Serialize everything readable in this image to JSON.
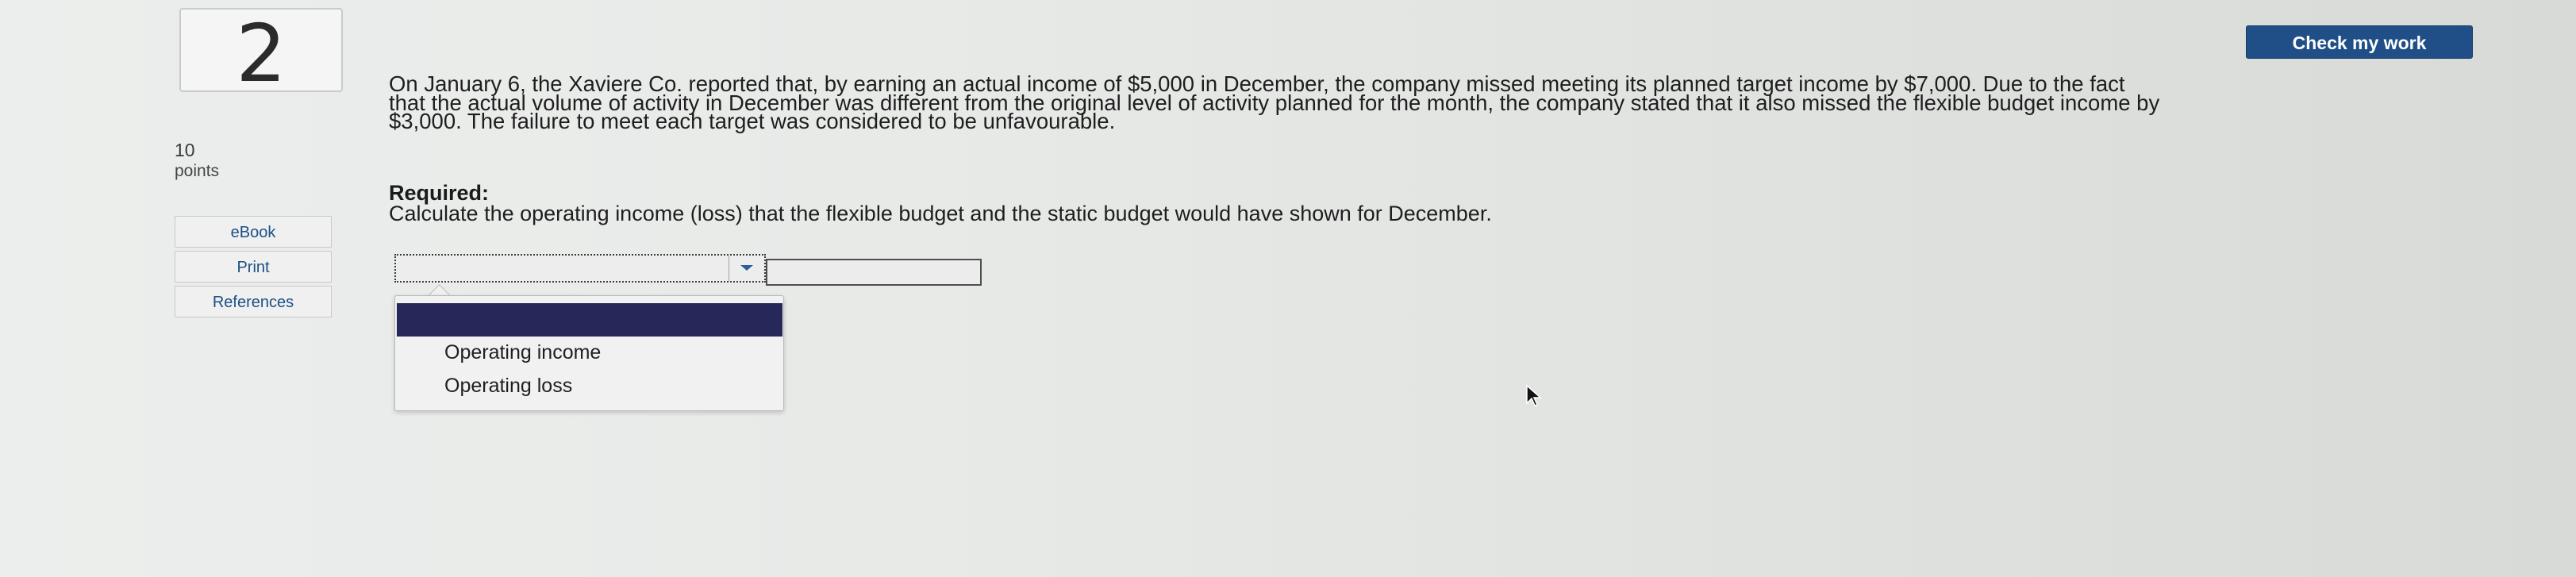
{
  "question": {
    "number": "2",
    "points_value": "10",
    "points_label": "points",
    "text": "On January 6, the Xaviere Co. reported that, by earning an actual income of $5,000 in December, the company missed meeting its planned target income by $7,000. Due to the fact that the actual volume of activity in December was different from the original level of activity planned for the month, the company stated that it also missed the flexible budget income by $3,000. The failure to meet each target was considered to be unfavourable.",
    "required_heading": "Required:",
    "instruction": "Calculate the operating income (loss) that the flexible budget and the static budget would have shown for December."
  },
  "sidebar": {
    "links": [
      {
        "label": "eBook"
      },
      {
        "label": "Print"
      },
      {
        "label": "References"
      }
    ]
  },
  "toolbar": {
    "check_label": "Check my work"
  },
  "answer": {
    "select_value": "",
    "amount_value": "",
    "dropdown_options": [
      {
        "label": ""
      },
      {
        "label": "Operating income"
      },
      {
        "label": "Operating loss"
      }
    ]
  },
  "colors": {
    "accent": "#1f4f86",
    "dropdown_highlight": "#26285a"
  }
}
